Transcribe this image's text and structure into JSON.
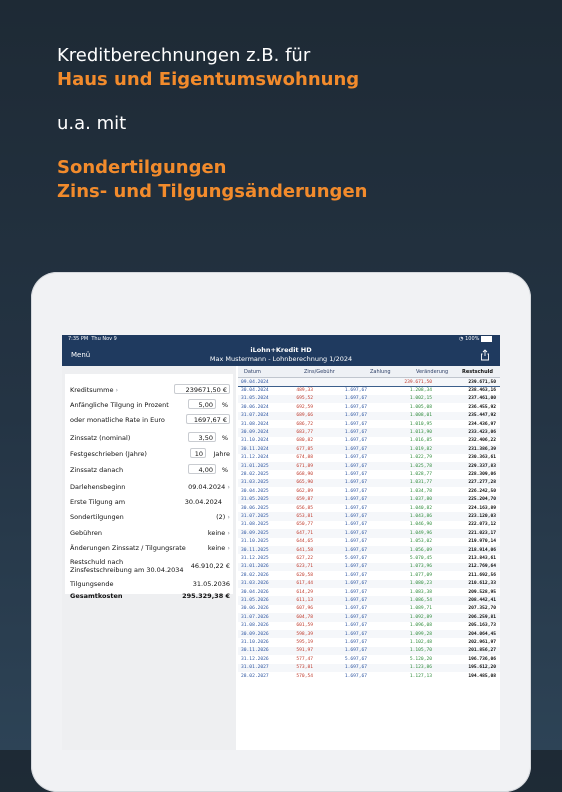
{
  "promo": {
    "line1": "Kreditberechnungen z.B. für",
    "line2": "Haus und Eigentumswohnung",
    "line3": "u.a. mit",
    "line4": "Sondertilgungen",
    "line5": "Zins- und Tilgungsänderungen"
  },
  "status": {
    "time": "7:35 PM",
    "date": "Thu Nov 9",
    "battery": "100%"
  },
  "nav": {
    "menu": "Menü",
    "title": "iLohn+Kredit HD",
    "subtitle": "Max Mustermann - Lohnberechnung 1/2024"
  },
  "form": {
    "kreditsumme": {
      "label": "Kreditsumme",
      "value": "239671,50 €"
    },
    "tilgung": {
      "label": "Anfängliche Tilgung in Prozent",
      "value": "5,00",
      "unit": "%"
    },
    "rate": {
      "label": "oder monatliche Rate in Euro",
      "value": "1697,67 €"
    },
    "zinssatz": {
      "label": "Zinssatz (nominal)",
      "value": "3,50",
      "unit": "%"
    },
    "fest": {
      "label": "Festgeschrieben (Jahre)",
      "value": "10",
      "unit": "Jahre"
    },
    "zinsdanach": {
      "label": "Zinssatz danach",
      "value": "4,00",
      "unit": "%"
    },
    "beginn": {
      "label": "Darlehensbeginn",
      "value": "09.04.2024"
    },
    "ersteTilgung": {
      "label": "Erste Tilgung am",
      "value": "30.04.2024"
    },
    "sonder": {
      "label": "Sondertilgungen",
      "value": "(2)"
    },
    "gebuehren": {
      "label": "Gebühren",
      "value": "keine"
    },
    "aenderungen": {
      "label": "Änderungen Zinssatz / Tilgungsrate",
      "value": "keine"
    },
    "restschuld": {
      "label1": "Restschuld nach",
      "label2": "Zinsfestschreibung am 30.04.2034",
      "value": "46.910,22 €"
    },
    "tilgungsende": {
      "label": "Tilgungsende",
      "value": "31.05.2036"
    },
    "gesamtkosten": {
      "label": "Gesamtkosten",
      "value": "295.329,38 €"
    }
  },
  "table": {
    "headers": [
      "Datum",
      "Zins/Gebühr",
      "Zahlung",
      "Veränderung",
      "Restschuld"
    ],
    "rows": [
      [
        "09.04.2024",
        "",
        "",
        "239.671,50",
        "239.671,50"
      ],
      [
        "30.04.2024",
        "489,33",
        "1.697,67",
        "1.208,34",
        "238.463,16"
      ],
      [
        "31.05.2024",
        "695,52",
        "1.697,67",
        "1.002,15",
        "237.461,00"
      ],
      [
        "30.06.2024",
        "692,59",
        "1.697,67",
        "1.005,08",
        "236.455,92"
      ],
      [
        "31.07.2024",
        "689,66",
        "1.697,67",
        "1.008,01",
        "235.447,92"
      ],
      [
        "31.08.2024",
        "686,72",
        "1.697,67",
        "1.010,95",
        "234.436,97"
      ],
      [
        "30.09.2024",
        "683,77",
        "1.697,67",
        "1.013,90",
        "233.423,06"
      ],
      [
        "31.10.2024",
        "680,82",
        "1.697,67",
        "1.016,85",
        "232.406,22"
      ],
      [
        "30.11.2024",
        "677,85",
        "1.697,67",
        "1.019,82",
        "231.386,39"
      ],
      [
        "31.12.2024",
        "674,88",
        "1.697,67",
        "1.022,79",
        "230.363,61"
      ],
      [
        "31.01.2025",
        "671,89",
        "1.697,67",
        "1.025,78",
        "229.337,83"
      ],
      [
        "28.02.2025",
        "668,90",
        "1.697,67",
        "1.028,77",
        "228.309,06"
      ],
      [
        "31.03.2025",
        "665,90",
        "1.697,67",
        "1.031,77",
        "227.277,28"
      ],
      [
        "30.04.2025",
        "662,89",
        "1.697,67",
        "1.034,78",
        "226.242,50"
      ],
      [
        "31.05.2025",
        "659,87",
        "1.697,67",
        "1.037,80",
        "225.204,70"
      ],
      [
        "30.06.2025",
        "656,85",
        "1.697,67",
        "1.040,82",
        "224.163,89"
      ],
      [
        "31.07.2025",
        "653,81",
        "1.697,67",
        "1.043,86",
        "223.120,03"
      ],
      [
        "31.08.2025",
        "650,77",
        "1.697,67",
        "1.046,90",
        "222.073,12"
      ],
      [
        "30.09.2025",
        "647,71",
        "1.697,67",
        "1.049,96",
        "221.023,17"
      ],
      [
        "31.10.2025",
        "644,65",
        "1.697,67",
        "1.053,02",
        "219.970,14"
      ],
      [
        "30.11.2025",
        "641,58",
        "1.697,67",
        "1.056,09",
        "218.914,06"
      ],
      [
        "31.12.2025",
        "627,22",
        "5.697,67",
        "5.070,45",
        "213.843,61"
      ],
      [
        "31.01.2026",
        "623,71",
        "1.697,67",
        "1.073,96",
        "212.769,64"
      ],
      [
        "28.02.2026",
        "620,58",
        "1.697,67",
        "1.077,09",
        "211.692,56"
      ],
      [
        "31.03.2026",
        "617,44",
        "1.697,67",
        "1.080,23",
        "210.612,33"
      ],
      [
        "30.04.2026",
        "614,29",
        "1.697,67",
        "1.083,38",
        "209.528,95"
      ],
      [
        "31.05.2026",
        "611,13",
        "1.697,67",
        "1.086,54",
        "208.442,41"
      ],
      [
        "30.06.2026",
        "607,96",
        "1.697,67",
        "1.089,71",
        "207.352,70"
      ],
      [
        "31.07.2026",
        "604,78",
        "1.697,67",
        "1.092,89",
        "206.259,81"
      ],
      [
        "31.08.2026",
        "601,59",
        "1.697,67",
        "1.096,08",
        "205.163,73"
      ],
      [
        "30.09.2026",
        "598,39",
        "1.697,67",
        "1.099,28",
        "204.064,45"
      ],
      [
        "31.10.2026",
        "595,19",
        "1.697,67",
        "1.102,48",
        "202.961,97"
      ],
      [
        "30.11.2026",
        "591,97",
        "1.697,67",
        "1.105,70",
        "201.856,27"
      ],
      [
        "31.12.2026",
        "577,47",
        "5.697,67",
        "5.120,20",
        "196.736,06"
      ],
      [
        "31.01.2027",
        "573,81",
        "1.697,67",
        "1.123,86",
        "195.612,20"
      ],
      [
        "28.02.2027",
        "570,54",
        "1.697,67",
        "1.127,13",
        "194.485,08"
      ]
    ]
  },
  "colors": {
    "accent": "#f28b2c",
    "navbar": "#1f3a5f"
  }
}
